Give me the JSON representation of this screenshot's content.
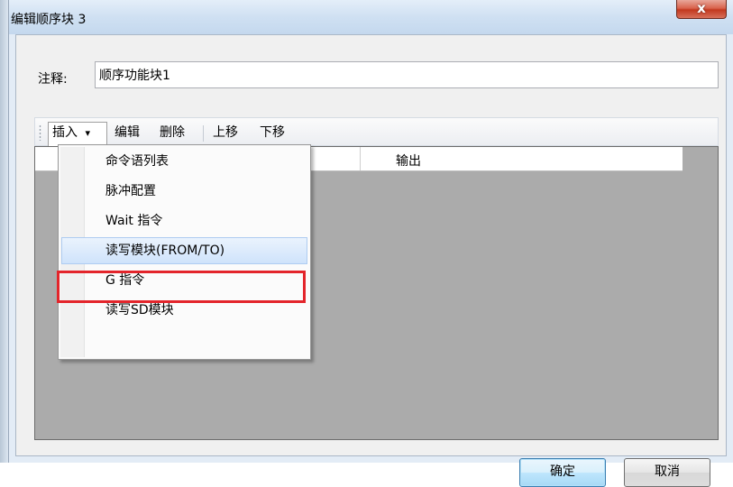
{
  "window": {
    "title": "编辑顺序块 3",
    "close_label": "x"
  },
  "comment": {
    "label": "注释:",
    "value": "顺序功能块1"
  },
  "toolbar": {
    "insert": "插入",
    "insert_arrow": "▾",
    "edit": "编辑",
    "delete": "删除",
    "move_up": "上移",
    "move_down": "下移"
  },
  "table": {
    "columns": [
      "",
      "输出"
    ]
  },
  "insert_menu": {
    "items": [
      "命令语列表",
      "脉冲配置",
      "Wait 指令",
      "读写模块(FROM/TO)",
      "G 指令",
      "读写SD模块"
    ],
    "highlighted_index": 3
  },
  "buttons": {
    "ok": "确定",
    "cancel": "取消"
  },
  "colors": {
    "highlight_frame": "#e3252b",
    "grid_background": "#ababab",
    "close_button": "#c2391f"
  }
}
